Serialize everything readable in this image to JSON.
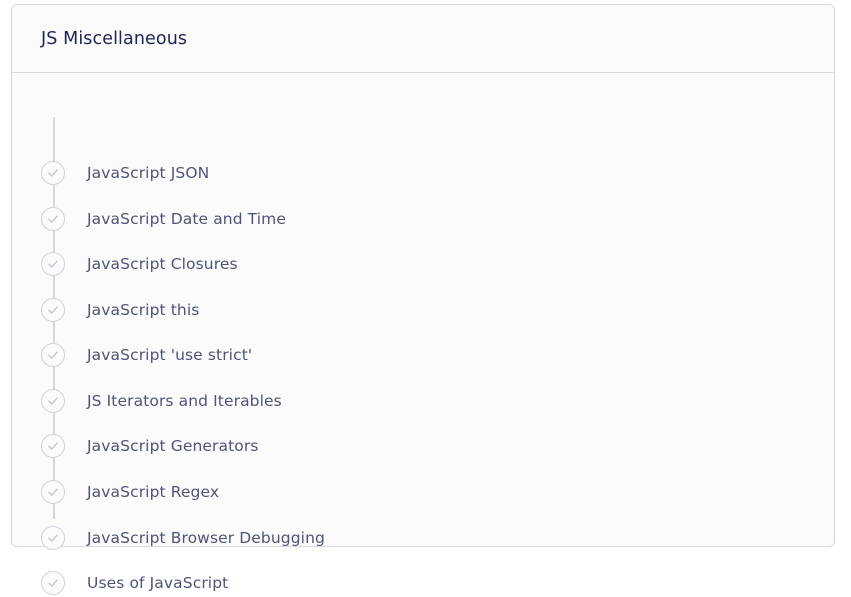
{
  "section": {
    "title": "JS Miscellaneous",
    "items": [
      {
        "label": "JavaScript JSON",
        "icon": "check-circle-icon"
      },
      {
        "label": "JavaScript Date and Time",
        "icon": "check-circle-icon"
      },
      {
        "label": "JavaScript Closures",
        "icon": "check-circle-icon"
      },
      {
        "label": "JavaScript this",
        "icon": "check-circle-icon"
      },
      {
        "label": "JavaScript 'use strict'",
        "icon": "check-circle-icon"
      },
      {
        "label": "JS Iterators and Iterables",
        "icon": "check-circle-icon"
      },
      {
        "label": "JavaScript Generators",
        "icon": "check-circle-icon"
      },
      {
        "label": "JavaScript Regex",
        "icon": "check-circle-icon"
      },
      {
        "label": "JavaScript Browser Debugging",
        "icon": "check-circle-icon"
      },
      {
        "label": "Uses of JavaScript",
        "icon": "check-circle-icon"
      }
    ]
  },
  "colors": {
    "title": "#1e2353",
    "label": "#4f5477",
    "border": "#d9dbe1",
    "timeline": "#d2d6e0"
  }
}
